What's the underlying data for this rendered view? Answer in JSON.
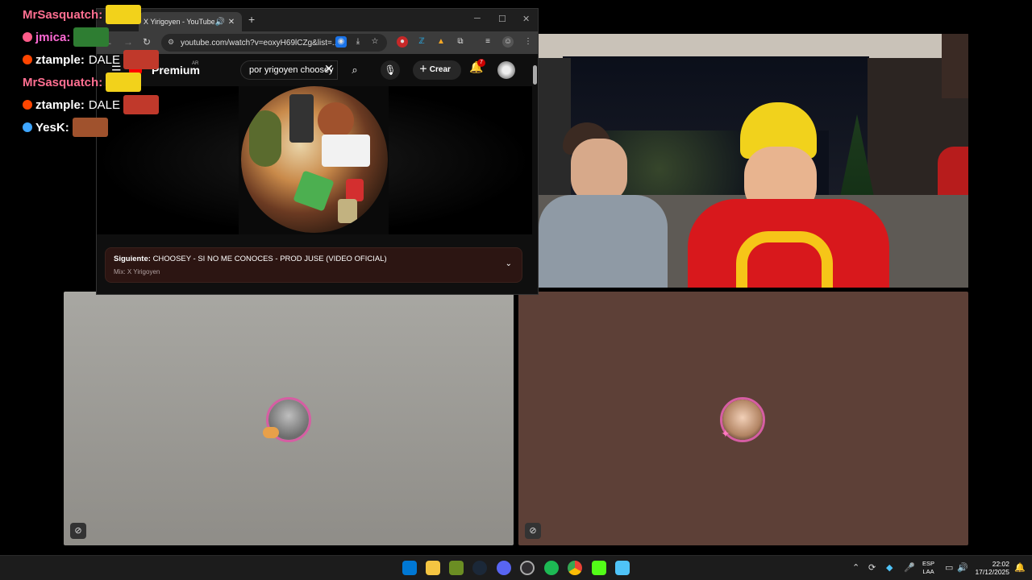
{
  "chat": {
    "messages": [
      {
        "user": "MrSasquatch:",
        "message": "",
        "user_color": "#ff6f91",
        "badge": false,
        "emote_color": "#f2d21b"
      },
      {
        "user": "jmica:",
        "message": "",
        "user_color": "#ff6ad5",
        "badge": true,
        "badge_color": "#ff5c8a",
        "emote_color": "#2e7d32"
      },
      {
        "user": "ztample:",
        "message": "DALE",
        "user_color": "#ffffff",
        "badge": true,
        "badge_color": "#ff4500",
        "emote_color": "#c0392b"
      },
      {
        "user": "MrSasquatch:",
        "message": "",
        "user_color": "#ff6f91",
        "badge": false,
        "emote_color": "#f2d21b"
      },
      {
        "user": "ztample:",
        "message": "DALE",
        "user_color": "#ffffff",
        "badge": true,
        "badge_color": "#ff4500",
        "emote_color": "#c0392b"
      },
      {
        "user": "YesK:",
        "message": "",
        "user_color": "#ffffff",
        "badge": true,
        "badge_color": "#3ea6ff",
        "emote_color": "#a0522d"
      }
    ]
  },
  "browser": {
    "tab_title": "X Yirigoyen - YouTube",
    "url": "youtube.com/watch?v=eoxyH69lCZg&list=...",
    "new_tab": "+",
    "back": "←",
    "forward": "→",
    "reload": "↻"
  },
  "youtube": {
    "logo": "Premium",
    "country": "AR",
    "search_value": "por yrigoyen choosey",
    "create_label": "Crear",
    "notifications": "7",
    "up_next": {
      "label": "Siguiente:",
      "title": "CHOOSEY - SI NO ME CONOCES - PROD JUSE (VIDEO OFICIAL)",
      "mix": "Mix: X Yirigoyen"
    }
  },
  "taskbar": {
    "language": "ESP",
    "layout": "LAA",
    "time": "22:02",
    "date": "17/12/2025",
    "apps": [
      "windows-start",
      "file-explorer",
      "minecraft",
      "steam",
      "discord",
      "obs",
      "spotify",
      "chrome",
      "kick",
      "notepad"
    ]
  },
  "colors": {
    "accent_pink": "#d65ea3",
    "yt_red": "#cc0000",
    "tile_left": "#a09f9a",
    "tile_right": "#5d4037"
  }
}
